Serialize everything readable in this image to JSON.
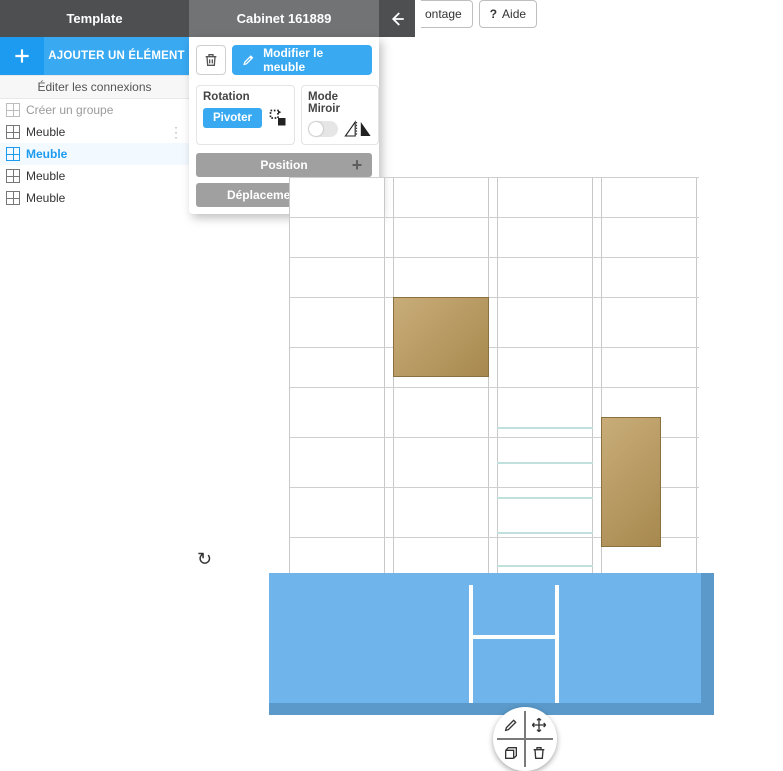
{
  "tabs": {
    "template": "Template",
    "cabinet": "Cabinet 161889"
  },
  "top_buttons": {
    "montage_partial": "ontage",
    "help_glyph": "?",
    "help": "Aide"
  },
  "sidebar": {
    "add_label": "AJOUTER UN ÉLÉMENT",
    "edit_connections": "Éditer les connexions",
    "create_group": "Créer un groupe",
    "items": [
      {
        "label": "Meuble",
        "selected": false,
        "has_handle": true
      },
      {
        "label": "Meuble",
        "selected": true,
        "has_handle": false
      },
      {
        "label": "Meuble",
        "selected": false,
        "has_handle": false
      },
      {
        "label": "Meuble",
        "selected": false,
        "has_handle": false
      }
    ]
  },
  "panel": {
    "modify": "Modifier le meuble",
    "rotation_label": "Rotation",
    "rotate_btn": "Pivoter",
    "mirror_label": "Mode Miroir",
    "position": "Position",
    "quick_move": "Déplacement rapide"
  },
  "icons": {
    "back": "←",
    "plus": "+",
    "handle": "⋮"
  }
}
